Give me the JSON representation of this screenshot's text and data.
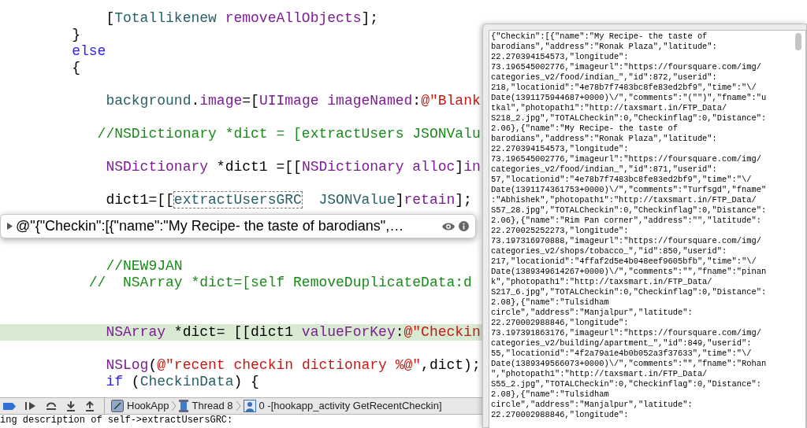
{
  "editor": {
    "lines": [
      {
        "kind": "blank"
      },
      {
        "kind": "code",
        "current": false,
        "tokens": [
          {
            "kind": "plain",
            "text": "        ["
          },
          {
            "kind": "ivar",
            "text": "Totallikenew "
          },
          {
            "kind": "method",
            "text": "removeAllObjects"
          },
          {
            "kind": "plain",
            "text": "];"
          }
        ]
      },
      {
        "kind": "code",
        "current": false,
        "tokens": [
          {
            "kind": "plain",
            "text": "    }"
          }
        ]
      },
      {
        "kind": "code",
        "current": false,
        "tokens": [
          {
            "kind": "keyword",
            "text": "    else"
          }
        ]
      },
      {
        "kind": "code",
        "current": false,
        "tokens": [
          {
            "kind": "plain",
            "text": "    {"
          }
        ]
      },
      {
        "kind": "blank"
      },
      {
        "kind": "code",
        "current": false,
        "tokens": [
          {
            "kind": "ivar",
            "text": "        background"
          },
          {
            "kind": "plain",
            "text": "."
          },
          {
            "kind": "method",
            "text": "image"
          },
          {
            "kind": "plain",
            "text": "=["
          },
          {
            "kind": "class",
            "text": "UIImage "
          },
          {
            "kind": "method",
            "text": "imageNamed"
          },
          {
            "kind": "plain",
            "text": ":"
          },
          {
            "kind": "string",
            "text": "@\"Blank"
          }
        ]
      },
      {
        "kind": "blank"
      },
      {
        "kind": "code",
        "current": false,
        "tokens": [
          {
            "kind": "comment",
            "text": "       //NSDictionary *dict = [extractUsers JSONValu"
          }
        ]
      },
      {
        "kind": "blank"
      },
      {
        "kind": "code",
        "current": false,
        "tokens": [
          {
            "kind": "class",
            "text": "        NSDictionary"
          },
          {
            "kind": "plain",
            "text": " *dict1 =[["
          },
          {
            "kind": "class",
            "text": "NSDictionary "
          },
          {
            "kind": "method",
            "text": "alloc"
          },
          {
            "kind": "plain",
            "text": "]"
          },
          {
            "kind": "method",
            "text": "in"
          }
        ]
      },
      {
        "kind": "blank"
      },
      {
        "kind": "code",
        "current": false,
        "tokens": [
          {
            "kind": "plain",
            "text": "        dict1=[["
          },
          {
            "kind": "ivar",
            "text": "extractUsersGRC",
            "boxed": true
          },
          {
            "kind": "ivar",
            "text": "  JSONValue"
          },
          {
            "kind": "plain",
            "text": "]"
          },
          {
            "kind": "method",
            "text": "retain"
          },
          {
            "kind": "plain",
            "text": "];"
          }
        ]
      },
      {
        "kind": "blank"
      },
      {
        "kind": "blank"
      },
      {
        "kind": "blank"
      },
      {
        "kind": "code",
        "current": false,
        "tokens": [
          {
            "kind": "comment",
            "text": "        //NEW9JAN"
          }
        ]
      },
      {
        "kind": "code",
        "current": false,
        "tokens": [
          {
            "kind": "comment",
            "text": "      //  NSArray *dict=[self RemoveDuplicateData:d"
          }
        ]
      },
      {
        "kind": "blank"
      },
      {
        "kind": "blank"
      },
      {
        "kind": "code",
        "current": true,
        "tokens": [
          {
            "kind": "class",
            "text": "        NSArray"
          },
          {
            "kind": "plain",
            "text": " *dict= [[dict1 "
          },
          {
            "kind": "method",
            "text": "valueForKey"
          },
          {
            "kind": "plain",
            "text": ":"
          },
          {
            "kind": "string",
            "text": "@\"Checkin"
          }
        ]
      },
      {
        "kind": "blank"
      },
      {
        "kind": "code",
        "current": false,
        "tokens": [
          {
            "kind": "method",
            "text": "        NSLog"
          },
          {
            "kind": "plain",
            "text": "("
          },
          {
            "kind": "string",
            "text": "@\"recent checkin dictionary %@\""
          },
          {
            "kind": "plain",
            "text": ",dict);"
          }
        ]
      },
      {
        "kind": "code",
        "current": false,
        "tokens": [
          {
            "kind": "keyword",
            "text": "        if"
          },
          {
            "kind": "plain",
            "text": " ("
          },
          {
            "kind": "ivar",
            "text": "CheckinData"
          },
          {
            "kind": "plain",
            "text": ") {"
          }
        ]
      }
    ]
  },
  "datatip": {
    "value": "@\"{\"Checkin\":[{\"name\":\"My Recipe- the taste of barodians\",…"
  },
  "debug_bar": {
    "breadcrumbs": [
      "HookApp",
      "Thread 8",
      "0 -[hookapp_activity GetRecentCheckin]"
    ]
  },
  "console": {
    "lines": [
      "ing description of self->extractUsersGRC:"
    ]
  },
  "popover": {
    "lines": [
      "{\"Checkin\":[{\"name\":\"My Recipe- the taste of",
      "barodians\",\"address\":\"Ronak Plaza\",\"latitude\":",
      "22.270394154573,\"longitude\":",
      "73.196545002776,\"imageurl\":\"https://foursquare.com/img/",
      "categories_v2/food/indian_\",\"id\":872,\"userid\":",
      "218,\"locationid\":\"4e78b7f7483bc8fe83ed2bf9\",\"time\":\"\\/",
      "Date(1391175944687+0000)\\/\",\"comments\":\"(\"\")\",\"fname\":\"u",
      "tkal\",\"photopath1\":\"http://taxsmart.in/FTP_Data/",
      "S218_2.jpg\",\"TOTALCheckin\":0,\"Checkinflag\":0,\"Distance\":",
      "2.06},{\"name\":\"My Recipe- the taste of",
      "barodians\",\"address\":\"Ronak Plaza\",\"latitude\":",
      "22.270394154573,\"longitude\":",
      "73.196545002776,\"imageurl\":\"https://foursquare.com/img/",
      "categories_v2/food/indian_\",\"id\":871,\"userid\":",
      "57,\"locationid\":\"4e78b7f7483bc8fe83ed2bf9\",\"time\":\"\\/",
      "Date(1391174361753+0000)\\/\",\"comments\":\"Turfsgd\",\"fname\"",
      ":\"Abhishek\",\"photopath1\":\"http://taxsmart.in/FTP_Data/",
      "S57_28.jpg\",\"TOTALCheckin\":0,\"Checkinflag\":0,\"Distance\":",
      "2.06},{\"name\":\"Rim Pan corner\",\"address\":\"\",\"latitude\":",
      "22.270025252273,\"longitude\":",
      "73.197316970888,\"imageurl\":\"https://foursquare.com/img/",
      "categories_v2/shops/tobacco_\",\"id\":850,\"userid\":",
      "217,\"locationid\":\"4ffaf2d5e4b048eef9605bfb\",\"time\":\"\\/",
      "Date(1389349614267+0000)\\/\",\"comments\":\"\",\"fname\":\"pinan",
      "k\",\"photopath1\":\"http://taxsmart.in/FTP_Data/",
      "S217_6.jpg\",\"TOTALCheckin\":0,\"Checkinflag\":0,\"Distance\":",
      "2.08},{\"name\":\"Tulsidham",
      "circle\",\"address\":\"Manjalpur\",\"latitude\":",
      "22.270002988846,\"longitude\":",
      "73.197391863176,\"imageurl\":\"https://foursquare.com/img/",
      "categories_v2/building/apartment_\",\"id\":849,\"userid\":",
      "55,\"locationid\":\"4f2a79a1e4b0b052a3f37633\",\"time\":\"\\/",
      "Date(1389349566073+0000)\\/\",\"comments\":\"\",\"fname\":\"Rohan",
      "\",\"photopath1\":\"http://taxsmart.in/FTP_Data/",
      "S55_2.jpg\",\"TOTALCheckin\":0,\"Checkinflag\":0,\"Distance\":",
      "2.08},{\"name\":\"Tulsidham",
      "circle\",\"address\":\"Manjalpur\",\"latitude\":",
      "22.270002988846,\"longitude\":"
    ]
  }
}
